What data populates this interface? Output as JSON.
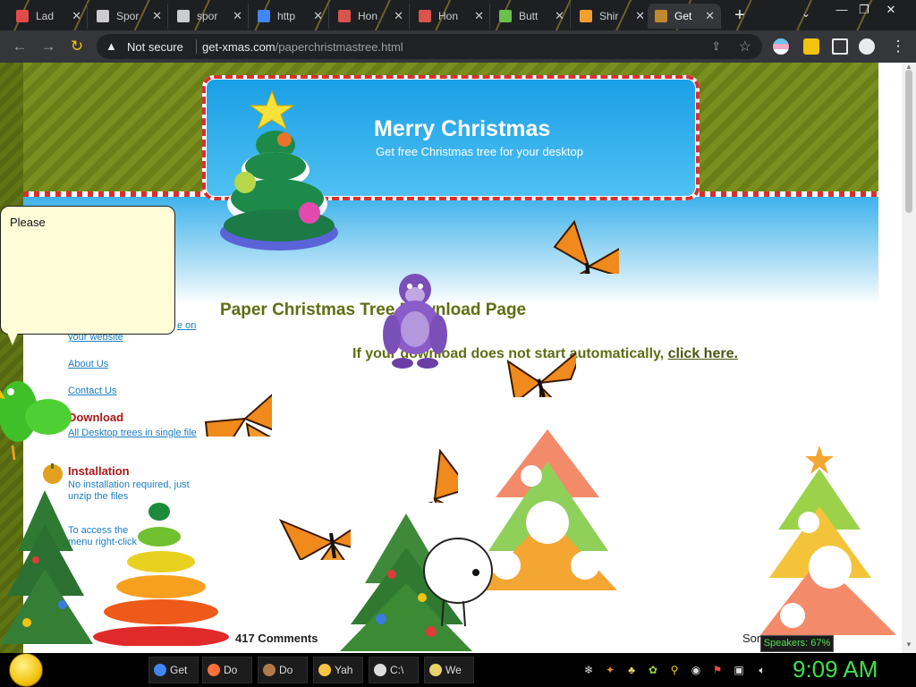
{
  "browser": {
    "tabs": [
      {
        "label": "Lad",
        "icon": "flag-icon",
        "color": "#e24b4b"
      },
      {
        "label": "Spor",
        "icon": "bank-icon",
        "color": "#cccccc"
      },
      {
        "label": "spor",
        "icon": "bank-icon",
        "color": "#cccccc"
      },
      {
        "label": "http",
        "icon": "google-icon",
        "color": "#4285f4"
      },
      {
        "label": "Hon",
        "icon": "record-icon",
        "color": "#d9534f"
      },
      {
        "label": "Hon",
        "icon": "record-icon",
        "color": "#d9534f"
      },
      {
        "label": "Butt",
        "icon": "leaf-icon",
        "color": "#6ac04a"
      },
      {
        "label": "Shir",
        "icon": "rainbow-icon",
        "color": "#f0a030"
      },
      {
        "label": "Get",
        "icon": "tree-icon",
        "color": "#c08a2a",
        "active": true
      }
    ],
    "new_tab": "+",
    "address": {
      "security": "Not secure",
      "domain": "get-xmas.com",
      "path": "/paperchristmastree.html"
    }
  },
  "banner": {
    "title": "Merry Christmas",
    "subtitle": "Get free Christmas tree for your desktop"
  },
  "page": {
    "heading": "Paper Christmas Tree Download Page",
    "download_prefix": "If your download does not start automatically,",
    "download_link": "click here.",
    "sidebar": {
      "link_partial_1": "e on",
      "link_partial_2": "your website",
      "about": "About Us",
      "contact": "Contact Us",
      "download_head": "Download",
      "download_link": "All Desktop trees in single file",
      "install_head": "Installation",
      "install_text": "No installation required, just unzip the files",
      "access_text": "To access the menu right-click"
    },
    "comments": "417 Comments",
    "sort": "Sort"
  },
  "bubble": {
    "text": "Please"
  },
  "tooltip": {
    "speakers": "Speakers: 67%"
  },
  "taskbar": {
    "tasks": [
      {
        "label": "Get",
        "color": "#4285f4"
      },
      {
        "label": "Do",
        "color": "#ff7139"
      },
      {
        "label": "Do",
        "color": "#b07b4a"
      },
      {
        "label": "Yah",
        "color": "#f6c445"
      },
      {
        "label": "C:\\",
        "color": "#dddddd"
      },
      {
        "label": "We",
        "color": "#e8d36b"
      }
    ],
    "clock": "9:09 AM"
  },
  "colors": {
    "page_green": "#5e6e13",
    "banner_blue": "#1a9fe6",
    "link_blue": "#1a7dc4",
    "heading_red": "#b01515",
    "clock_green": "#3ee04a"
  }
}
